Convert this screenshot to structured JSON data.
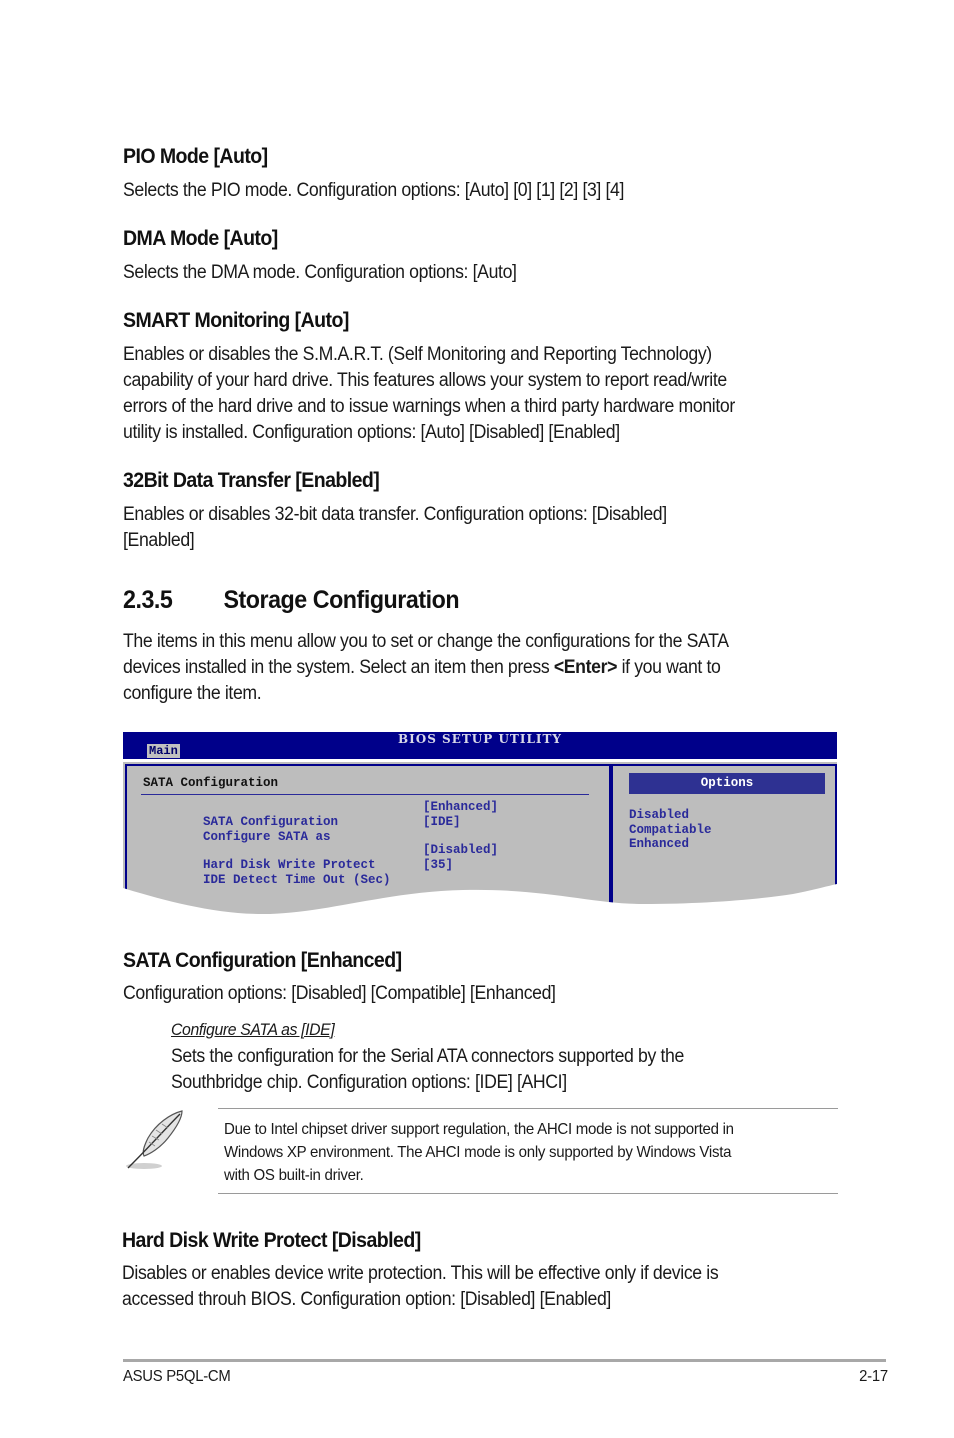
{
  "sections": {
    "pio_mode": {
      "heading": "PIO Mode [Auto]",
      "body": "Selects the PIO mode. Configuration options: [Auto] [0] [1] [2] [3] [4]"
    },
    "dma_mode": {
      "heading": "DMA Mode [Auto]",
      "body": "Selects the DMA mode. Configuration options: [Auto]"
    },
    "smart_monitoring": {
      "heading": "SMART Monitoring [Auto]",
      "lines": [
        "Enables or disables the S.M.A.R.T. (Self Monitoring and Reporting Technology)",
        "capability of your hard drive. This features allows your system to report read/write",
        "errors of the hard drive and to issue warnings when a third party hardware monitor",
        "utility is installed. Configuration options: [Auto] [Disabled] [Enabled]"
      ]
    },
    "bit32_transfer": {
      "heading": "32Bit Data Transfer [Enabled]",
      "lines": [
        "Enables or disables 32-bit data transfer. Configuration options: [Disabled]",
        "[Enabled]"
      ]
    },
    "storage_config": {
      "number": "2.3.5",
      "title": "Storage Configuration",
      "line1": "The items in this menu allow you to set or change the configurations for the SATA",
      "line2_pre": "devices installed in the system. Select an item then press ",
      "line2_key": "<Enter>",
      "line2_post": " if you want to",
      "line3": "configure the item."
    },
    "sata_config": {
      "heading": "SATA Configuration [Enhanced]",
      "body": "Configuration options: [Disabled] [Compatible] [Enhanced]",
      "sub_heading": "Configure SATA as [IDE]",
      "sub_lines": [
        "Sets the configuration for the Serial ATA connectors supported by the",
        "Southbridge chip. Configuration options: [IDE] [AHCI]"
      ]
    },
    "note": {
      "icon": "feather-pen-icon",
      "lines": [
        "Due to Intel chipset driver support regulation, the AHCI mode is not supported in",
        "Windows XP environment. The AHCI mode is only supported by Windows Vista",
        "with OS built-in driver."
      ]
    },
    "hd_write_protect": {
      "heading": "Hard Disk Write Protect [Disabled]",
      "lines": [
        "Disables or enables device write protection. This will be effective only if device is",
        "accessed throuh BIOS. Configuration option: [Disabled] [Enabled]"
      ]
    }
  },
  "bios": {
    "title": "BIOS SETUP UTILITY",
    "active_tab": "Main",
    "section_title": "SATA Configuration",
    "rows": [
      {
        "label": "SATA Configuration",
        "value": "[Enhanced]"
      },
      {
        "label": "Configure SATA as",
        "value": "[IDE]"
      },
      {
        "label": "Hard Disk Write Protect",
        "value": "[Disabled]"
      },
      {
        "label": "IDE Detect Time Out (Sec)",
        "value": "[35]"
      }
    ],
    "options_header": "Options",
    "options": [
      "Disabled",
      "Compatiable",
      "Enhanced"
    ],
    "colors": {
      "title_bar": "#00008a",
      "panel_bg": "#bdbdbd",
      "item_text": "#2a2a9a",
      "options_header_bg": "#2e3192"
    }
  },
  "footer": {
    "left": "ASUS P5QL-CM",
    "right": "2-17"
  }
}
